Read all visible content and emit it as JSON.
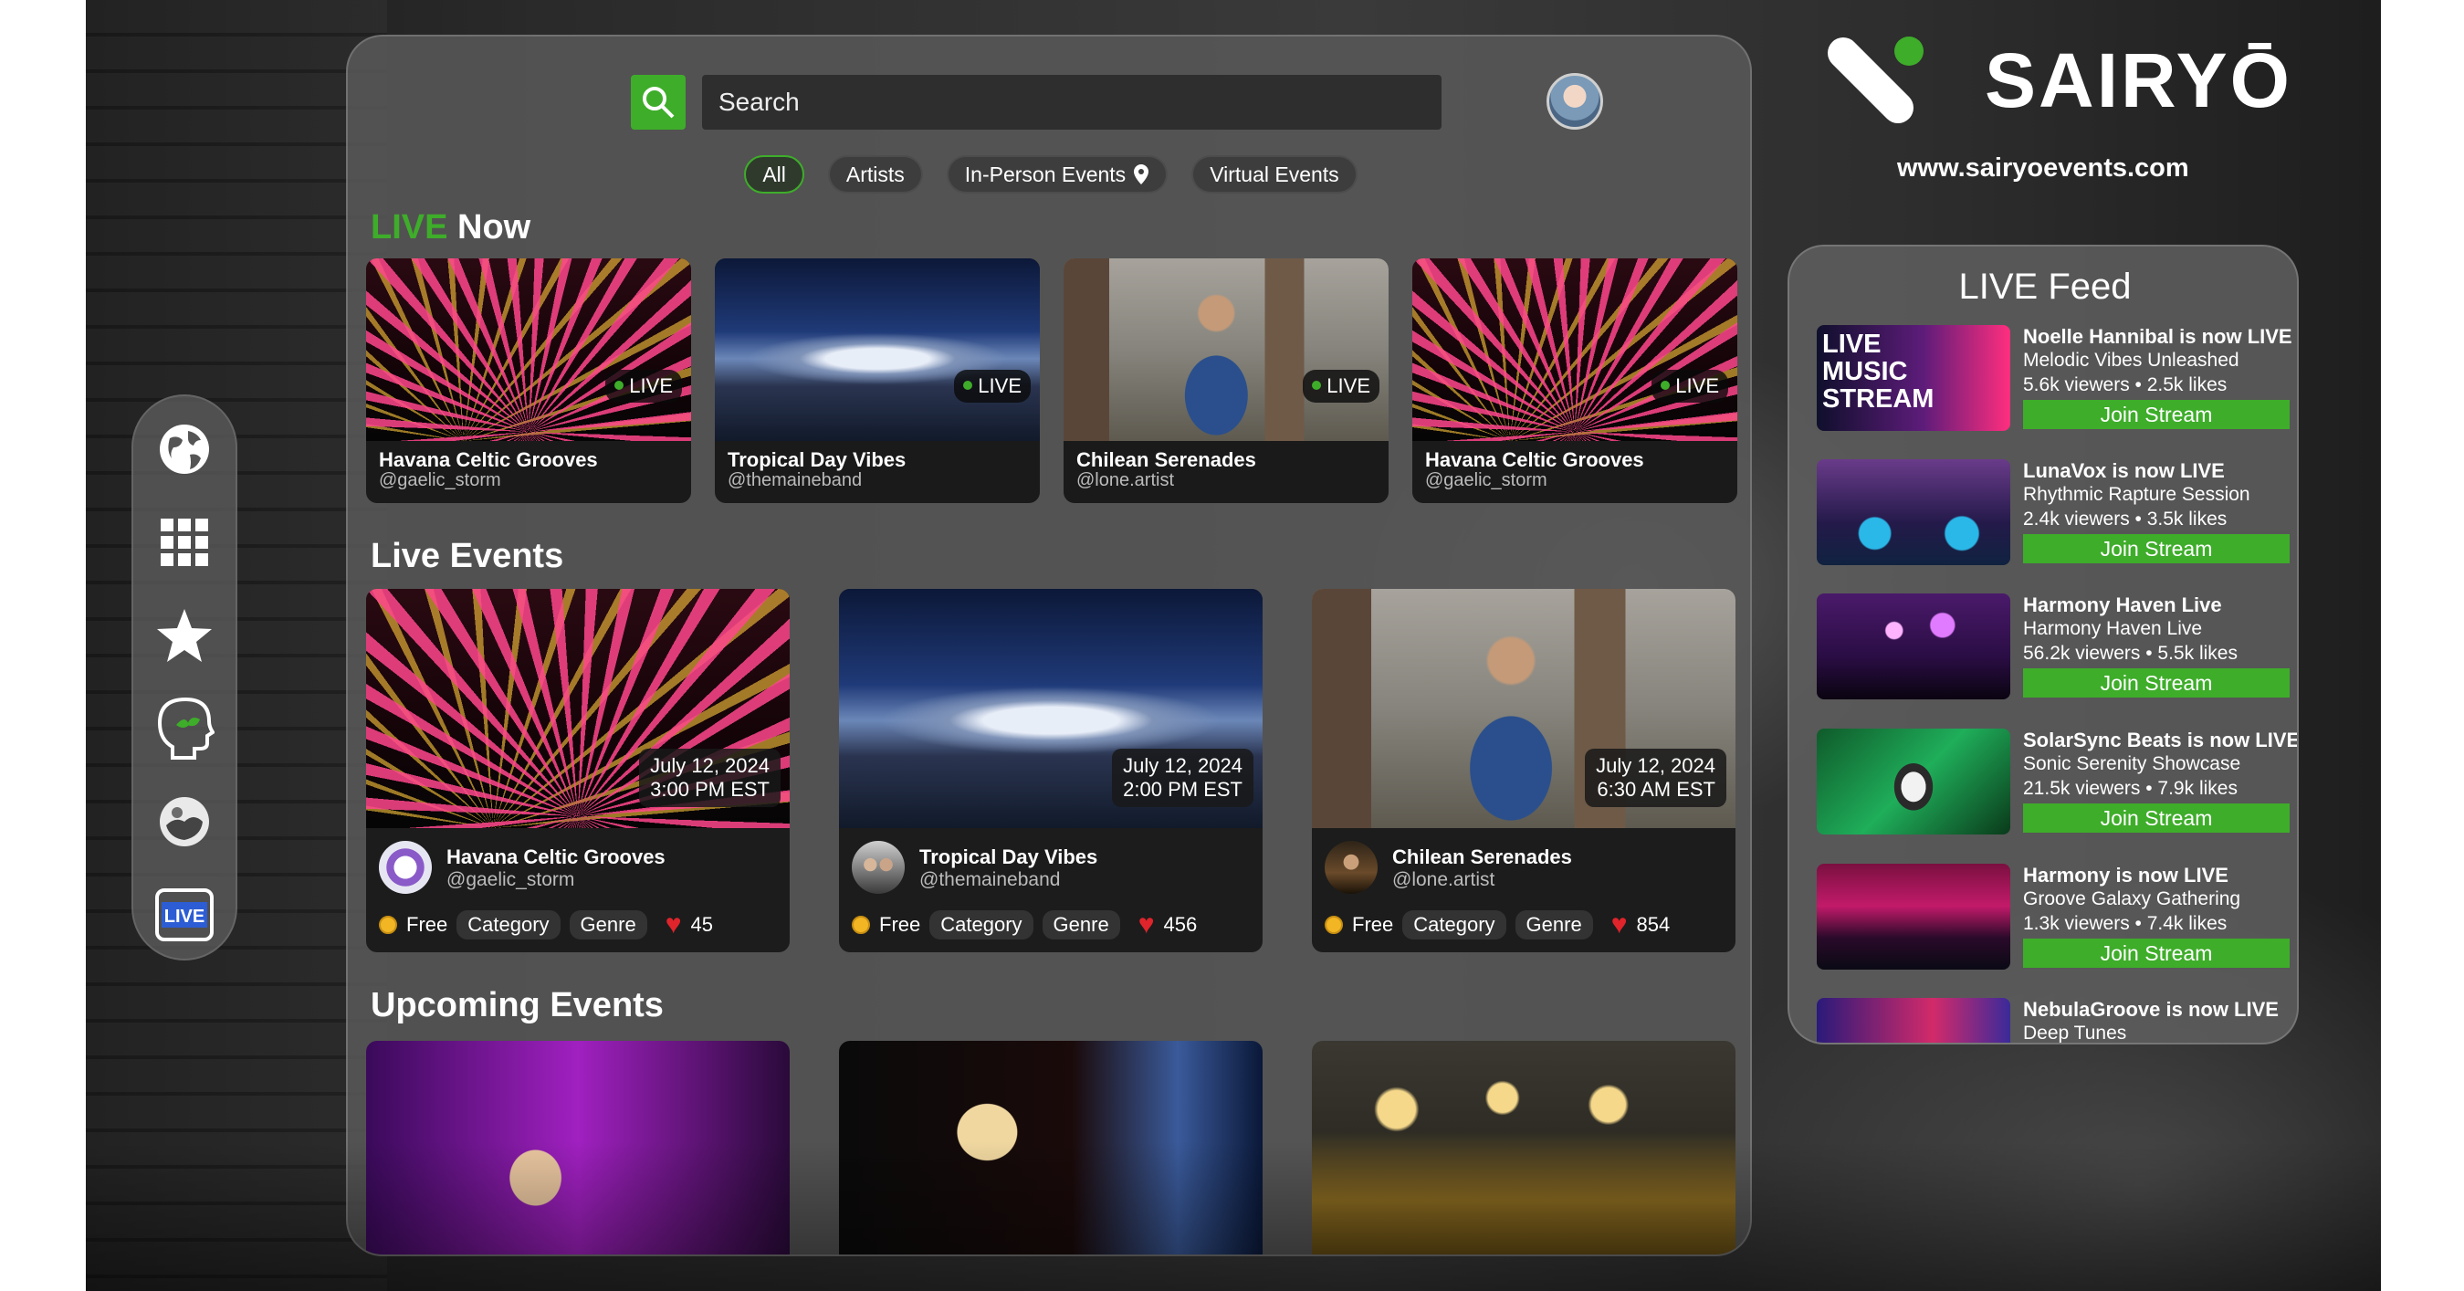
{
  "brand": {
    "name": "SAIRYŌ",
    "url": "www.sairyoevents.com"
  },
  "search": {
    "placeholder": "Search"
  },
  "filters": [
    {
      "label": "All",
      "active": true
    },
    {
      "label": "Artists",
      "active": false
    },
    {
      "label": "In-Person Events",
      "active": false
    },
    {
      "label": "Virtual Events",
      "active": false
    }
  ],
  "sidebar": [
    "globe-icon",
    "grid-icon",
    "star-icon",
    "wellness-head-icon",
    "world-image-icon",
    "live-icon"
  ],
  "sidebar_live_label": "LIVE",
  "live_now": {
    "title_accent": "LIVE",
    "title_rest": " Now",
    "badge": "LIVE",
    "items": [
      {
        "title": "Havana Celtic Grooves",
        "handle": "@gaelic_storm"
      },
      {
        "title": "Tropical Day Vibes",
        "handle": "@themaineband"
      },
      {
        "title": "Chilean Serenades",
        "handle": "@lone.artist"
      },
      {
        "title": "Havana Celtic Grooves",
        "handle": "@gaelic_storm"
      }
    ]
  },
  "live_events": {
    "title": "Live Events",
    "items": [
      {
        "date": "July 12, 2024",
        "time": "3:00 PM EST",
        "name": "Havana Celtic Grooves",
        "handle": "@gaelic_storm",
        "price": "Free",
        "category": "Category",
        "genre": "Genre",
        "likes": "45"
      },
      {
        "date": "July 12, 2024",
        "time": "2:00 PM EST",
        "name": "Tropical Day Vibes",
        "handle": "@themaineband",
        "price": "Free",
        "category": "Category",
        "genre": "Genre",
        "likes": "456"
      },
      {
        "date": "July 12, 2024",
        "time": "6:30 AM EST",
        "name": "Chilean Serenades",
        "handle": "@lone.artist",
        "price": "Free",
        "category": "Category",
        "genre": "Genre",
        "likes": "854"
      }
    ]
  },
  "upcoming": {
    "title": "Upcoming Events"
  },
  "feed": {
    "title": "LIVE Feed",
    "join_label": "Join Stream",
    "thumb_text": "LIVE MUSIC STREAM",
    "items": [
      {
        "headline": "Noelle Hannibal is now LIVE",
        "show": "Melodic Vibes Unleashed",
        "stats": "5.6k viewers  •  2.5k likes"
      },
      {
        "headline": "LunaVox is now LIVE",
        "show": "Rhythmic Rapture Session",
        "stats": "2.4k viewers  •  3.5k likes"
      },
      {
        "headline": "Harmony Haven Live",
        "show": "Harmony Haven Live",
        "stats": "56.2k viewers  •  5.5k likes"
      },
      {
        "headline": "SolarSync Beats is now LIVE",
        "show": "Sonic Serenity Showcase",
        "stats": "21.5k viewers  •  7.9k likes"
      },
      {
        "headline": "Harmony is now LIVE",
        "show": "Groove Galaxy Gathering",
        "stats": "1.3k viewers  •  7.4k likes"
      },
      {
        "headline": "NebulaGroove is now LIVE",
        "show": "Deep Tunes",
        "stats": ""
      }
    ]
  },
  "colors": {
    "accent": "#3ead2a",
    "heart": "#e0242b",
    "coin": "#f2b624"
  }
}
